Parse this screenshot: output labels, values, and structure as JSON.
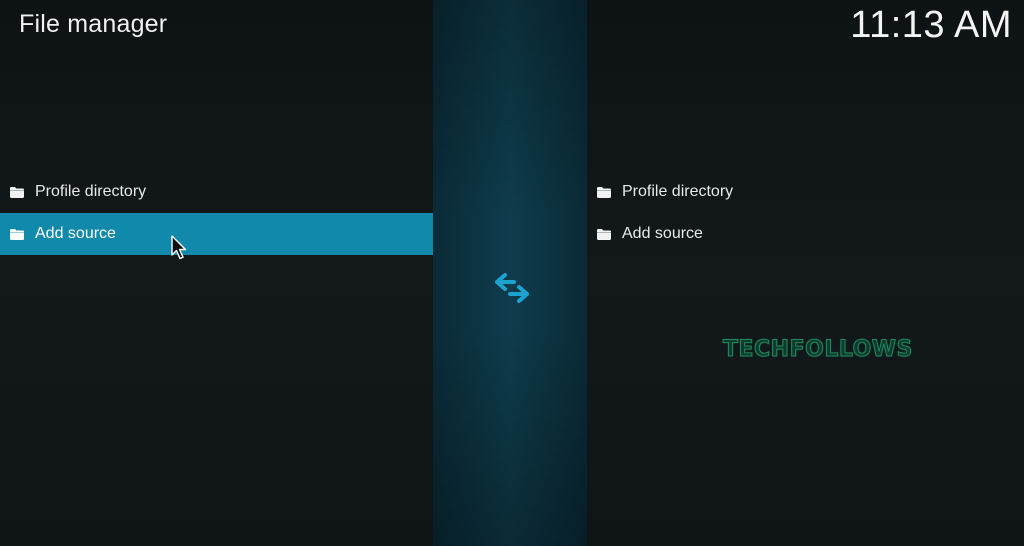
{
  "header": {
    "title": "File manager",
    "clock": "11:13 AM"
  },
  "left_list": {
    "items": [
      {
        "label": "Profile directory",
        "icon": "folder-icon",
        "selected": false
      },
      {
        "label": "Add source",
        "icon": "folder-icon",
        "selected": true
      }
    ]
  },
  "right_list": {
    "items": [
      {
        "label": "Profile directory",
        "icon": "folder-icon"
      },
      {
        "label": "Add source",
        "icon": "folder-icon"
      }
    ]
  },
  "center": {
    "icon": "swap-arrows-icon"
  },
  "watermark": {
    "text": "TECHFOLLOWS"
  },
  "colors": {
    "background": "#111618",
    "center_panel": "#0e3c4d",
    "selection": "#1089aa",
    "swap_icon": "#1aa3d0"
  }
}
